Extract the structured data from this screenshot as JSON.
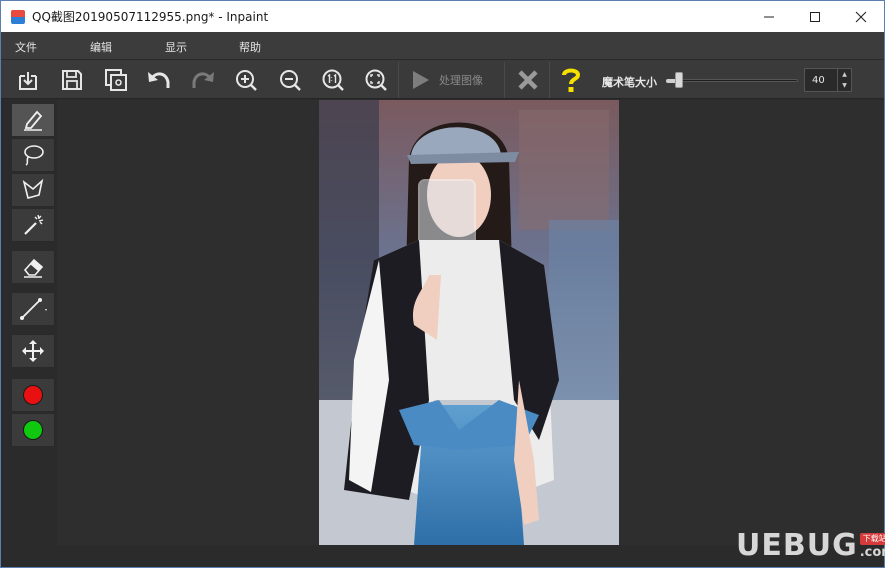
{
  "window": {
    "title": "QQ截图20190507112955.png* - Inpaint"
  },
  "menu": {
    "items": [
      {
        "label": "文件"
      },
      {
        "label": "编辑"
      },
      {
        "label": "显示"
      },
      {
        "label": "帮助"
      }
    ]
  },
  "toolbar": {
    "process_label": "处理图像",
    "brush_size_label": "魔术笔大小",
    "brush_size_value": "40",
    "brush_size_fraction": 0.1
  },
  "tools": {
    "colors": {
      "marker_red": "#e81010",
      "marker_green": "#10c810"
    }
  },
  "watermark": {
    "brand": "UEBUG",
    "badge": "下载站",
    "suffix": ".com"
  }
}
